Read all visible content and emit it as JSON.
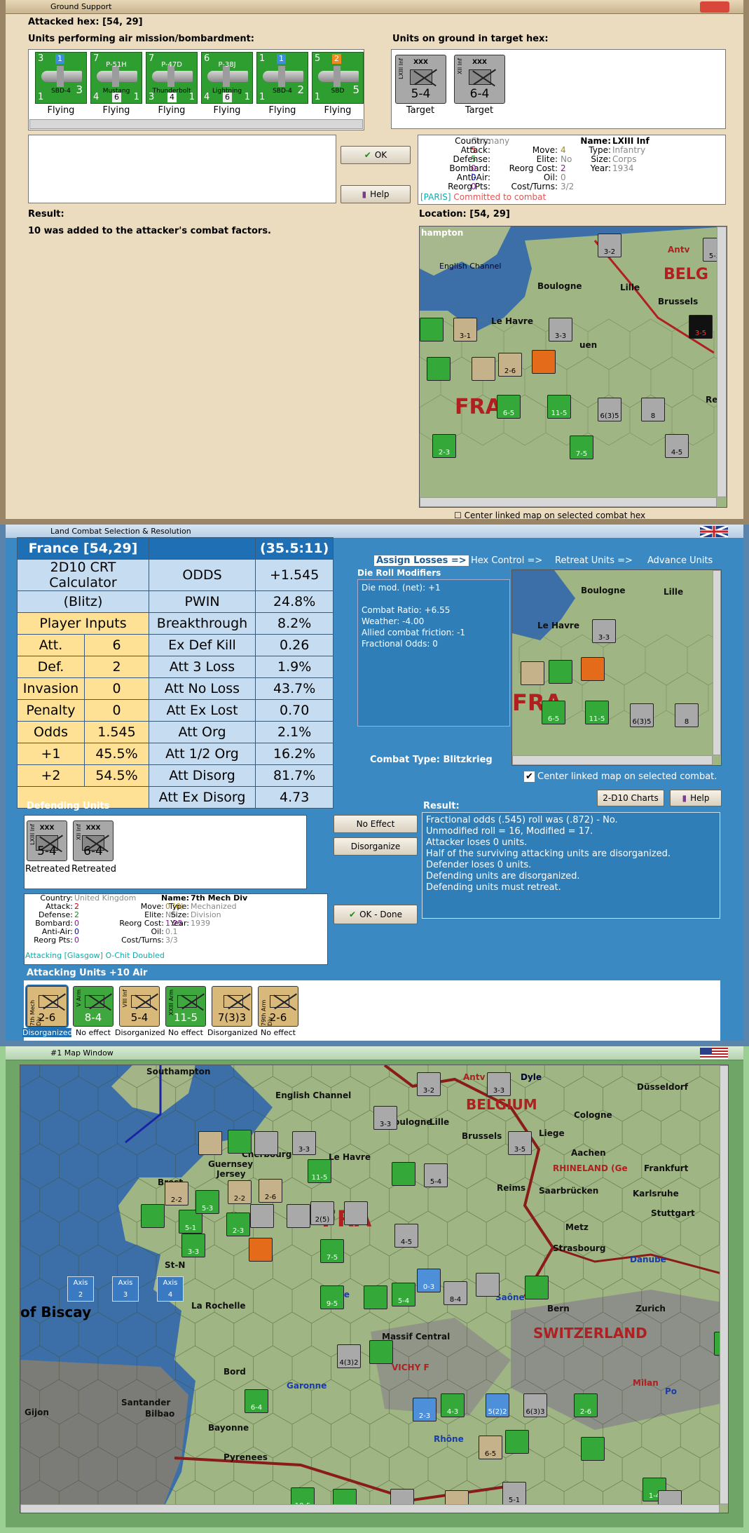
{
  "gs": {
    "title": "Ground Support",
    "attacked_hex": "Attacked hex: [54, 29]",
    "units_air_label": "Units performing air mission/bombardment:",
    "units_ground_label": "Units on ground in target hex:",
    "air_units": [
      {
        "name": "",
        "sub": "SBD-4",
        "tl": "3",
        "tr": "1",
        "mr": "3",
        "bl": "1",
        "status": "Flying"
      },
      {
        "name": "P-51H",
        "sub": "Mustang",
        "tl": "7",
        "tr": "",
        "mr": "",
        "bl": "4",
        "bm": "6",
        "br": "1",
        "status": "Flying"
      },
      {
        "name": "P-47D",
        "sub": "Thunderbolt",
        "tl": "7",
        "tr": "",
        "mr": "",
        "bl": "3",
        "bm": "4",
        "br": "1",
        "status": "Flying"
      },
      {
        "name": "P-38J",
        "sub": "Lightning",
        "tl": "6",
        "tr": "",
        "mr": "",
        "bl": "4",
        "bm": "6",
        "br": "1",
        "status": "Flying"
      },
      {
        "name": "",
        "sub": "SBD-4",
        "tl": "1",
        "tr": "1",
        "mr": "2",
        "bl": "1",
        "status": "Flying"
      },
      {
        "name": "",
        "sub": "SBD",
        "tl": "5",
        "tr": "2",
        "mr": "5",
        "bl": "1",
        "status": "Flying"
      }
    ],
    "ground_units": [
      {
        "name": "LXIII Inf",
        "size": "XXX",
        "strength": "5-4",
        "status": "Target"
      },
      {
        "name": "XII Inf",
        "size": "XXX",
        "strength": "6-4",
        "status": "Target"
      }
    ],
    "ok": "OK",
    "help": "Help",
    "result_label": "Result:",
    "result_text": "10 was added to the attacker's combat factors.",
    "location_label": "Location:  [54, 29]",
    "center_check": "Center linked map on selected combat hex",
    "info": {
      "country_k": "Country:",
      "country": "Germany",
      "attack_k": "Attack:",
      "attack": "5",
      "defense_k": "Defense:",
      "defense": "5",
      "bombard_k": "Bombard:",
      "bombard": "0",
      "antiair_k": "Anti-Air:",
      "antiair": "0",
      "reorg_k": "Reorg Pts:",
      "reorg": "0",
      "move_k": "Move:",
      "move": "4",
      "elite_k": "Elite:",
      "elite": "No",
      "reorgcost_k": "Reorg Cost:",
      "reorgcost": "2",
      "oil_k": "Oil:",
      "oil": "0",
      "cost_k": "Cost/Turns:",
      "cost": "3/2",
      "name_k": "Name:",
      "name": "LXIII Inf",
      "type_k": "Type:",
      "type": "Infantry",
      "size_k": "Size:",
      "size": "Corps",
      "year_k": "Year:",
      "year": "1934",
      "footer_a": "[PARIS]",
      "footer_b": "Committed to combat"
    },
    "map_labels": [
      "hampton",
      "English Channel",
      "Boulogne",
      "Lille",
      "Antv",
      "BELG",
      "Brussels",
      "Le Havre",
      "uen",
      "FRA",
      "Rei"
    ]
  },
  "lc": {
    "title": "Land Combat Selection & Resolution",
    "crt": {
      "header_left": "France [54,29]",
      "header_right": "(35.5:11)",
      "calc_title_1": "2D10 CRT Calculator",
      "calc_title_2": "(Blitz)",
      "player_inputs": "Player Inputs",
      "rows": [
        {
          "k": "Att.",
          "v": "6"
        },
        {
          "k": "Def.",
          "v": "2"
        },
        {
          "k": "Invasion",
          "v": "0"
        },
        {
          "k": "Penalty",
          "v": "0"
        },
        {
          "k": "Odds",
          "v": "1.545"
        },
        {
          "k": "+1",
          "v": "45.5%"
        },
        {
          "k": "+2",
          "v": "54.5%"
        }
      ],
      "results": [
        {
          "k": "ODDS",
          "v": "+1.545"
        },
        {
          "k": "PWIN",
          "v": "24.8%"
        },
        {
          "k": "Breakthrough",
          "v": "8.2%"
        },
        {
          "k": "Ex Def Kill",
          "v": "0.26"
        },
        {
          "k": "Att 3 Loss",
          "v": "1.9%"
        },
        {
          "k": "Att No Loss",
          "v": "43.7%"
        },
        {
          "k": "Att Ex Lost",
          "v": "0.70"
        },
        {
          "k": "Att Org",
          "v": "2.1%"
        },
        {
          "k": "Att 1/2 Org",
          "v": "16.2%"
        },
        {
          "k": "Att Disorg",
          "v": "81.7%"
        },
        {
          "k": "Att Ex Disorg",
          "v": "4.73"
        }
      ]
    },
    "tabs": [
      "Assign Losses =>",
      "Hex Control =>",
      "Retreat Units =>",
      "Advance Units"
    ],
    "die_label": "Die Roll Modifiers",
    "die_lines": [
      "Die mod. (net): +1",
      "",
      "Combat Ratio: +6.55",
      "Weather: -4.00",
      "Allied combat friction: -1",
      "Fractional Odds: 0"
    ],
    "combat_type": "Combat Type:  Blitzkrieg",
    "center_combat": "Center linked map on selected combat.",
    "btn_charts": "2-D10 Charts",
    "btn_help": "Help",
    "defending_label": "Defending Units",
    "defending": [
      {
        "name": "LXIII Inf",
        "size": "XXX",
        "strength": "5-4",
        "status": "Retreated"
      },
      {
        "name": "XII Inf",
        "size": "XXX",
        "strength": "6-4",
        "status": "Retreated"
      }
    ],
    "btn_no_effect": "No Effect",
    "btn_disorganize": "Disorganize",
    "btn_ok_done": "OK - Done",
    "result_label": "Result:",
    "result_lines": [
      "Fractional odds (.545) roll was (.872)  - No.",
      "Unmodified roll = 16, Modified = 17.",
      "Attacker loses 0 units.",
      "Half of the surviving attacking units are disorganized.",
      "Defender loses 0 units.",
      "Defending units are disorganized.",
      "Defending units must retreat."
    ],
    "info": {
      "country_k": "Country:",
      "country": "United Kingdom",
      "attack_k": "Attack:",
      "attack": "2",
      "defense_k": "Defense:",
      "defense": "2",
      "bombard_k": "Bombard:",
      "bombard": "0",
      "antiair_k": "Anti-Air:",
      "antiair": "0",
      "reorg_k": "Reorg Pts:",
      "reorg": "0",
      "move_k": "Move:",
      "move": "0 (6)",
      "elite_k": "Elite:",
      "elite": "No",
      "reorgcost_k": "Reorg Cost:",
      "reorgcost": "1.25",
      "oil_k": "Oil:",
      "oil": "0.1",
      "cost_k": "Cost/Turns:",
      "cost": "3/3",
      "name_k": "Name:",
      "name": "7th Mech Div",
      "type_k": "Type:",
      "type": "Mechanized",
      "size_k": "Size:",
      "size": "Division",
      "year_k": "Year:",
      "year": "1939",
      "footer": "Attacking [Glasgow] O-Chit Doubled"
    },
    "attacking_label": "Attacking Units +10 Air",
    "attacking": [
      {
        "name": "7th Mech Div",
        "strength": "2-6",
        "status": "Disorganized",
        "color": "sand"
      },
      {
        "name": "V Arm",
        "strength": "8-4",
        "status": "No effect",
        "color": "green"
      },
      {
        "name": "VIII Inf",
        "strength": "5-4",
        "status": "Disorganized",
        "color": "sand"
      },
      {
        "name": "XXIII Arm",
        "strength": "11-5",
        "status": "No effect",
        "color": "green"
      },
      {
        "name": "",
        "strength": "7(3)3",
        "status": "Disorganized",
        "color": "sand"
      },
      {
        "name": "79th Arm Div",
        "strength": "2-6",
        "status": "No effect",
        "color": "sand"
      }
    ]
  },
  "mw": {
    "title": "#1 Map Window",
    "cities": [
      "Southampton",
      "English Channel",
      "Boulogne",
      "Lille",
      "BELGIUM",
      "Antv",
      "Dyle",
      "Düsseldorf",
      "Cologne",
      "Brussels",
      "Liege",
      "Aachen",
      "Cherbourg",
      "Le Havre",
      "Guernsey",
      "Jersey",
      "RHINELAND (Ge",
      "Frankfurt",
      "Brest",
      "Reims",
      "Saarbrücken",
      "Karlsruhe",
      "Stuttgart",
      "FRA",
      "Metz",
      "Strasbourg",
      "St-N",
      "of Biscay",
      "Loire",
      "Saône",
      "Danube",
      "La Rochelle",
      "Massif Central",
      "Bern",
      "Zurich",
      "SWITZERLAND",
      "VICHY F",
      "Bord",
      "Garonne",
      "Milan",
      "Po",
      "Santander",
      "Bilbao",
      "Bayonne",
      "Pyrenees",
      "Rhône",
      "Gijon"
    ],
    "axis_boxes": [
      {
        "label": "Axis",
        "val": "2"
      },
      {
        "label": "Axis",
        "val": "3"
      },
      {
        "label": "Axis",
        "val": "4"
      }
    ]
  }
}
